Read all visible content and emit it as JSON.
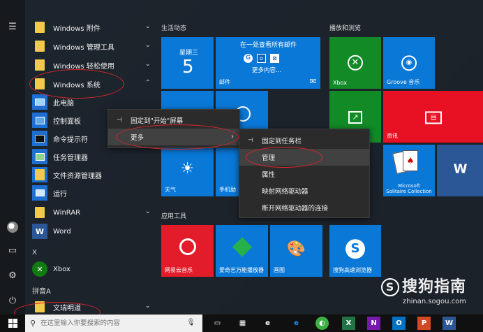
{
  "app_list": {
    "items": [
      {
        "label": "Windows 附件",
        "kind": "folder",
        "expanded": false
      },
      {
        "label": "Windows 管理工具",
        "kind": "folder",
        "expanded": false
      },
      {
        "label": "Windows 轻松使用",
        "kind": "folder",
        "expanded": false
      },
      {
        "label": "Windows 系统",
        "kind": "folder",
        "expanded": true
      },
      {
        "label": "此电脑",
        "kind": "sub"
      },
      {
        "label": "控制面板",
        "kind": "sub"
      },
      {
        "label": "命令提示符",
        "kind": "sub"
      },
      {
        "label": "任务管理器",
        "kind": "sub"
      },
      {
        "label": "文件资源管理器",
        "kind": "sub"
      },
      {
        "label": "运行",
        "kind": "sub"
      },
      {
        "label": "WinRAR",
        "kind": "folder",
        "expanded": false
      },
      {
        "label": "Word",
        "kind": "app"
      }
    ],
    "section_x": "X",
    "xbox_label": "Xbox",
    "section_pinyin": "拼音A",
    "last_item": "文瑞明道"
  },
  "tiles": {
    "group1_title": "生活动态",
    "group2_title": "播放和浏览",
    "group3_title": "应用工具",
    "calendar_weekday": "星期三",
    "calendar_day": "5",
    "mail_header": "在一处查看所有邮件",
    "mail_more": "更多内容...",
    "mail_label": "邮件",
    "xbox_label": "Xbox",
    "groove_label": "Groove 音乐",
    "news_label": "资讯",
    "solitaire_label_1": "Microsoft",
    "solitaire_label_2": "Solitaire Collection",
    "weather_label": "天气",
    "phone_label": "手机助",
    "netease_label": "网易云音乐",
    "aisi_label": "爱奇艺万能播放器",
    "paint_label": "画图",
    "sogou_label": "搜狗高速浏览器"
  },
  "context_menu_1": {
    "items": [
      "固定到\"开始\"屏幕",
      "更多"
    ]
  },
  "context_menu_2": {
    "items": [
      "固定到任务栏",
      "管理",
      "属性",
      "映射网络驱动器",
      "断开网络驱动器的连接"
    ]
  },
  "taskbar": {
    "search_placeholder": "在这里输入你要搜索的内容"
  },
  "watermark": {
    "text": "搜狗指南",
    "url": "zhinan.sogou.com"
  },
  "colors": {
    "tile_blue": "#0a78d7",
    "tile_green": "#128a26",
    "tile_red": "#e81123",
    "netease_red": "#e21c2a"
  }
}
